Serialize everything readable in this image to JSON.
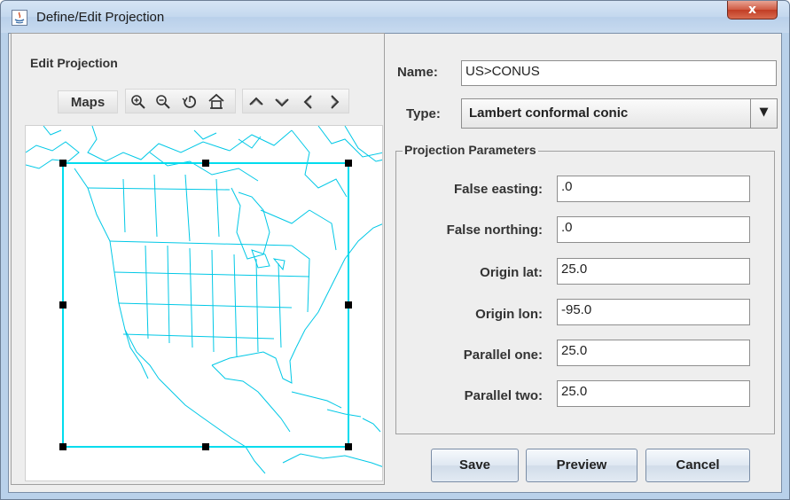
{
  "window": {
    "title": "Define/Edit Projection",
    "close_glyph": "x"
  },
  "edit_projection": {
    "legend": "Edit Projection",
    "maps_button": "Maps",
    "toolbar_icons": [
      "zoom-in-icon",
      "zoom-out-icon",
      "reset-icon",
      "home-icon",
      "pan-up-icon",
      "pan-down-icon",
      "pan-left-icon",
      "pan-right-icon"
    ],
    "map_color": "#00c8e6",
    "box_color": "#00dcee"
  },
  "form": {
    "name_label": "Name:",
    "name_value": "US>CONUS",
    "type_label": "Type:",
    "type_value": "Lambert conformal conic"
  },
  "params": {
    "legend": "Projection Parameters",
    "fields": [
      {
        "label": "False easting:",
        "value": ".0"
      },
      {
        "label": "False northing:",
        "value": ".0"
      },
      {
        "label": "Origin lat:",
        "value": "25.0"
      },
      {
        "label": "Origin lon:",
        "value": "-95.0"
      },
      {
        "label": "Parallel one:",
        "value": "25.0"
      },
      {
        "label": "Parallel two:",
        "value": "25.0"
      }
    ]
  },
  "buttons": {
    "save": "Save",
    "preview": "Preview",
    "cancel": "Cancel"
  }
}
